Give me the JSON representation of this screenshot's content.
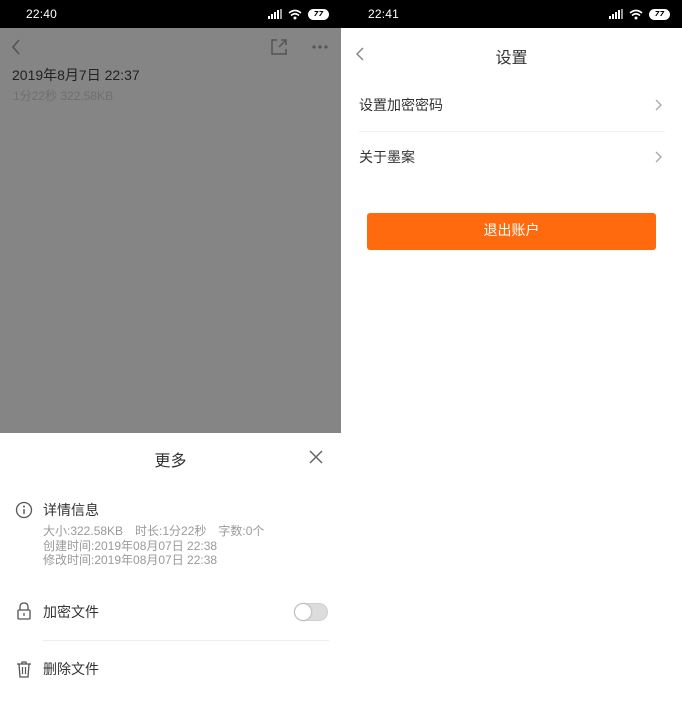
{
  "colors": {
    "accent": "#ff6a0e",
    "overlay": "#858585",
    "status_bar": "#000000"
  },
  "left": {
    "status_time": "22:40",
    "battery": "77",
    "note": {
      "title": "2019年8月7日 22:37",
      "meta": "1分22秒 322.58KB"
    },
    "sheet": {
      "title": "更多",
      "details_label": "详情信息",
      "size": "大小:322.58KB",
      "duration": "时长:1分22秒",
      "words": "字数:0个",
      "created": "创建时间:2019年08月07日 22:38",
      "modified": "修改时间:2019年08月07日 22:38",
      "encrypt_label": "加密文件",
      "encrypt_enabled": false,
      "delete_label": "删除文件"
    }
  },
  "right": {
    "status_time": "22:41",
    "battery": "77",
    "title": "设置",
    "rows": [
      {
        "label": "设置加密密码"
      },
      {
        "label": "关于墨案"
      }
    ],
    "logout_label": "退出账户"
  }
}
